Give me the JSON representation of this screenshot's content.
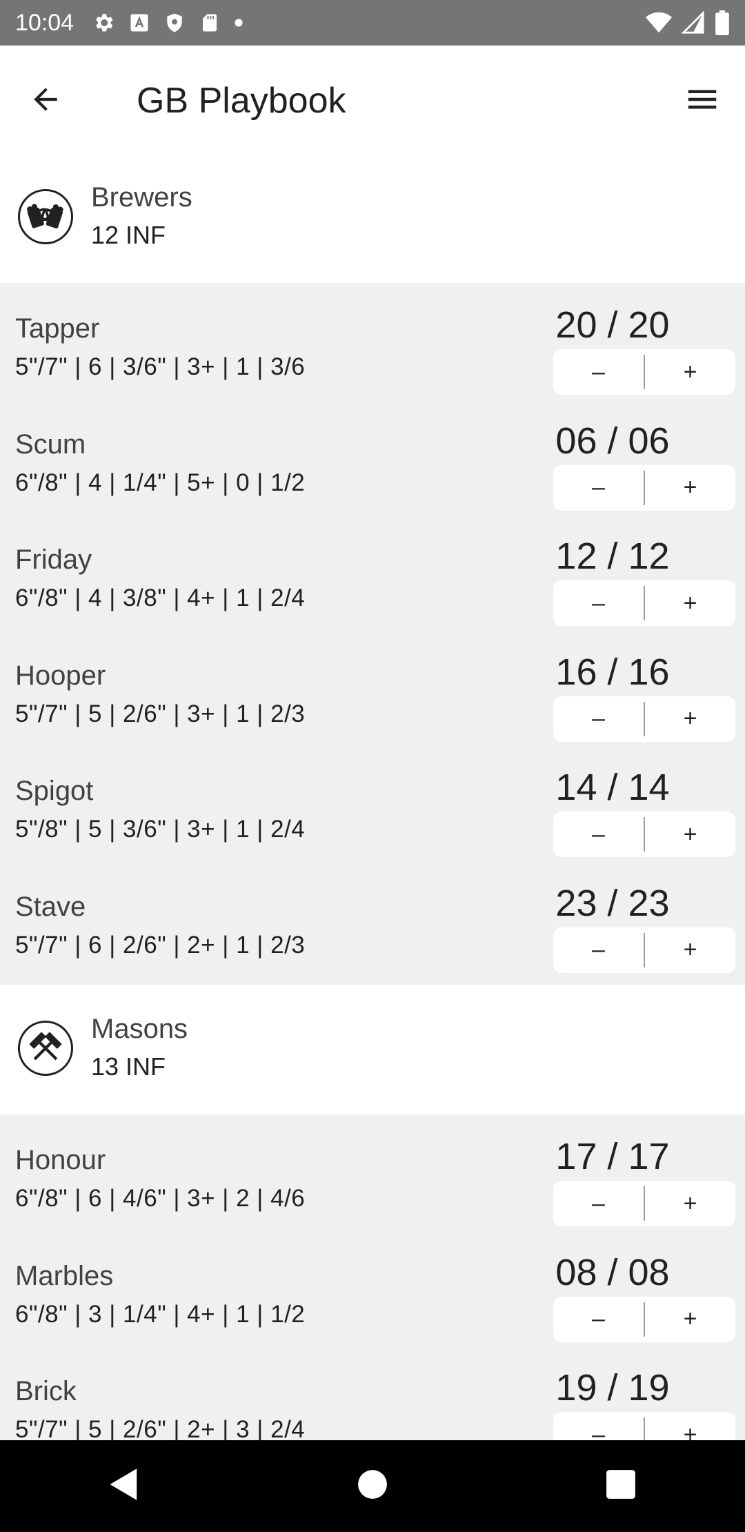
{
  "status_bar": {
    "time": "10:04",
    "left_icons": [
      "settings-icon",
      "text-a-icon",
      "shield-icon",
      "sd-card-icon",
      "dot-icon"
    ],
    "right_icons": [
      "wifi-icon",
      "signal-icon",
      "battery-icon"
    ]
  },
  "app_bar": {
    "title": "GB Playbook",
    "back_icon": "arrow-back-icon",
    "menu_icon": "hamburger-menu-icon"
  },
  "teams": [
    {
      "name": "Brewers",
      "inf": "12 INF",
      "emblem": "brewers-mugs-icon",
      "players": [
        {
          "name": "Tapper",
          "stats": "5\"/7\" | 6 | 3/6\" | 3+ | 1 | 3/6",
          "hp": "20 / 20",
          "minus": "–",
          "plus": "+"
        },
        {
          "name": "Scum",
          "stats": "6\"/8\" | 4 | 1/4\" | 5+ | 0 | 1/2",
          "hp": "06 / 06",
          "minus": "–",
          "plus": "+"
        },
        {
          "name": "Friday",
          "stats": "6\"/8\" | 4 | 3/8\" | 4+ | 1 | 2/4",
          "hp": "12 / 12",
          "minus": "–",
          "plus": "+"
        },
        {
          "name": "Hooper",
          "stats": "5\"/7\" | 5 | 2/6\" | 3+ | 1 | 2/3",
          "hp": "16 / 16",
          "minus": "–",
          "plus": "+"
        },
        {
          "name": "Spigot",
          "stats": "5\"/8\" | 5 | 3/6\" | 3+ | 1 | 2/4",
          "hp": "14 / 14",
          "minus": "–",
          "plus": "+"
        },
        {
          "name": "Stave",
          "stats": "5\"/7\" | 6 | 2/6\" | 2+ | 1 | 2/3",
          "hp": "23 / 23",
          "minus": "–",
          "plus": "+"
        }
      ]
    },
    {
      "name": "Masons",
      "inf": "13 INF",
      "emblem": "masons-hammers-icon",
      "players": [
        {
          "name": "Honour",
          "stats": "6\"/8\" | 6 | 4/6\" | 3+ | 2 | 4/6",
          "hp": "17 / 17",
          "minus": "–",
          "plus": "+"
        },
        {
          "name": "Marbles",
          "stats": "6\"/8\" | 3 | 1/4\" | 4+ | 1 | 1/2",
          "hp": "08 / 08",
          "minus": "–",
          "plus": "+"
        },
        {
          "name": "Brick",
          "stats": "5\"/7\" | 5 | 2/6\" | 2+ | 3 | 2/4",
          "hp": "19 / 19",
          "minus": "–",
          "plus": "+"
        }
      ]
    }
  ],
  "nav_bar": {
    "icons": [
      "nav-back-icon",
      "nav-home-icon",
      "nav-recents-icon"
    ]
  },
  "colors": {
    "status_bar": "#757575",
    "list_background": "#f0f0f0",
    "nav_bar": "#000000"
  }
}
